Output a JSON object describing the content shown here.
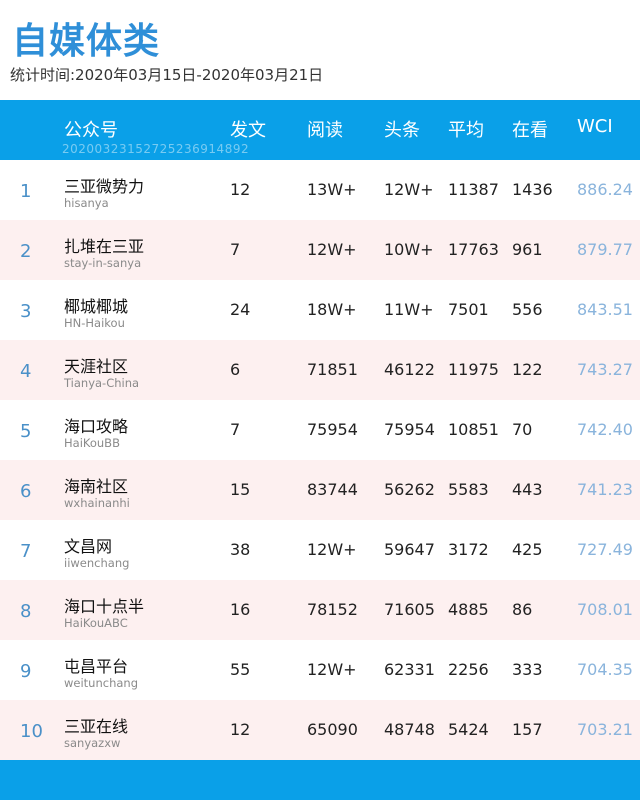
{
  "title": "自媒体类",
  "subtitle": "统计时间:2020年03月15日-2020年03月21日",
  "header": {
    "name": "公众号",
    "posts": "发文",
    "reads": "阅读",
    "headline": "头条",
    "average": "平均",
    "watching": "在看",
    "wci": "WCI",
    "watermark": "20200323152725236914892"
  },
  "rows": [
    {
      "rank": "1",
      "name": "三亚微势力",
      "handle": "hisanya",
      "posts": "12",
      "reads": "13W+",
      "headline": "12W+",
      "average": "11387",
      "watching": "1436",
      "wci": "886.24"
    },
    {
      "rank": "2",
      "name": "扎堆在三亚",
      "handle": "stay-in-sanya",
      "posts": "7",
      "reads": "12W+",
      "headline": "10W+",
      "average": "17763",
      "watching": "961",
      "wci": "879.77"
    },
    {
      "rank": "3",
      "name": "椰城椰城",
      "handle": "HN-Haikou",
      "posts": "24",
      "reads": "18W+",
      "headline": "11W+",
      "average": "7501",
      "watching": "556",
      "wci": "843.51"
    },
    {
      "rank": "4",
      "name": "天涯社区",
      "handle": "Tianya-China",
      "posts": "6",
      "reads": "71851",
      "headline": "46122",
      "average": "11975",
      "watching": "122",
      "wci": "743.27"
    },
    {
      "rank": "5",
      "name": "海口攻略",
      "handle": "HaiKouBB",
      "posts": "7",
      "reads": "75954",
      "headline": "75954",
      "average": "10851",
      "watching": "70",
      "wci": "742.40"
    },
    {
      "rank": "6",
      "name": "海南社区",
      "handle": "wxhainanhi",
      "posts": "15",
      "reads": "83744",
      "headline": "56262",
      "average": "5583",
      "watching": "443",
      "wci": "741.23"
    },
    {
      "rank": "7",
      "name": "文昌网",
      "handle": "iiwenchang",
      "posts": "38",
      "reads": "12W+",
      "headline": "59647",
      "average": "3172",
      "watching": "425",
      "wci": "727.49"
    },
    {
      "rank": "8",
      "name": "海口十点半",
      "handle": "HaiKouABC",
      "posts": "16",
      "reads": "78152",
      "headline": "71605",
      "average": "4885",
      "watching": "86",
      "wci": "708.01"
    },
    {
      "rank": "9",
      "name": "屯昌平台",
      "handle": "weitunchang",
      "posts": "55",
      "reads": "12W+",
      "headline": "62331",
      "average": "2256",
      "watching": "333",
      "wci": "704.35"
    },
    {
      "rank": "10",
      "name": "三亚在线",
      "handle": "sanyazxw",
      "posts": "12",
      "reads": "65090",
      "headline": "48748",
      "average": "5424",
      "watching": "157",
      "wci": "703.21"
    }
  ]
}
